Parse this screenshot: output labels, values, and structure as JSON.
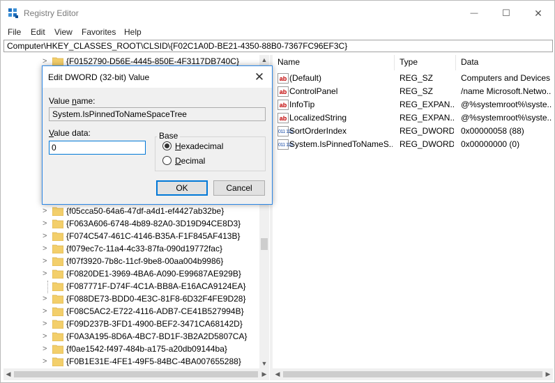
{
  "window": {
    "title": "Registry Editor",
    "minimize_glyph": "—",
    "maximize_glyph": "☐",
    "close_glyph": "✕"
  },
  "menu": [
    "File",
    "Edit",
    "View",
    "Favorites",
    "Help"
  ],
  "address": "Computer\\HKEY_CLASSES_ROOT\\CLSID\\{F02C1A0D-BE21-4350-88B0-7367FC96EF3C}",
  "tree": {
    "items": [
      "{F0152790-D56E-4445-850E-4F3117DB740C}",
      "{f05cca50-64a6-47df-a4d1-ef4427ab32be}",
      "{F063A606-6748-4b89-82A0-3D19D94CE8D3}",
      "{F074C547-461C-4146-B35A-F1F845AF413B}",
      "{f079ec7c-11a4-4c33-87fa-090d19772fac}",
      "{f07f3920-7b8c-11cf-9be8-00aa004b9986}",
      "{F0820DE1-3969-4BA6-A090-E99687AE929B}",
      "{F087771F-D74F-4C1A-BB8A-E16ACA9124EA}",
      "{F088DE73-BDD0-4E3C-81F8-6D32F4FE9D28}",
      "{F08C5AC2-E722-4116-ADB7-CE41B527994B}",
      "{F09D237B-3FD1-4900-BEF2-3471CA68142D}",
      "{F0A3A195-8D6A-4BC7-BD1F-3B2A2D5807CA}",
      "{f0ae1542-f497-484b-a175-a20db09144ba}",
      "{F0B1E31E-4FE1-49F5-84BC-4BA007655288}"
    ]
  },
  "list": {
    "columns": [
      "Name",
      "Type",
      "Data"
    ],
    "rows": [
      {
        "icon": "string-value-icon",
        "name": "(Default)",
        "type": "REG_SZ",
        "data": "Computers and Devices"
      },
      {
        "icon": "string-value-icon",
        "name": "ControlPanel",
        "type": "REG_SZ",
        "data": "/name Microsoft.Netwo..."
      },
      {
        "icon": "string-value-icon",
        "name": "InfoTip",
        "type": "REG_EXPAN...",
        "data": "@%systemroot%\\syste..."
      },
      {
        "icon": "string-value-icon",
        "name": "LocalizedString",
        "type": "REG_EXPAN...",
        "data": "@%systemroot%\\syste..."
      },
      {
        "icon": "binary-value-icon",
        "name": "SortOrderIndex",
        "type": "REG_DWORD",
        "data": "0x00000058 (88)"
      },
      {
        "icon": "binary-value-icon",
        "name": "System.IsPinnedToNameS...",
        "type": "REG_DWORD",
        "data": "0x00000000 (0)"
      }
    ]
  },
  "dialog": {
    "title": "Edit DWORD (32-bit) Value",
    "value_name_label": "Value name:",
    "value_name": "System.IsPinnedToNameSpaceTree",
    "value_data_label": "Value data:",
    "value_data": "0",
    "base_label": "Base",
    "hex_label": "Hexadecimal",
    "dec_label": "Decimal",
    "base_selected": "Hexadecimal",
    "ok_label": "OK",
    "cancel_label": "Cancel",
    "close_glyph": "✕"
  },
  "icons": {
    "string_glyph": "ab",
    "binary_glyph": "011\n110"
  },
  "colors": {
    "accent": "#0078d7",
    "folder": "#f3cf6b",
    "string_icon": "#c00000",
    "binary_icon": "#1b4ea8"
  }
}
